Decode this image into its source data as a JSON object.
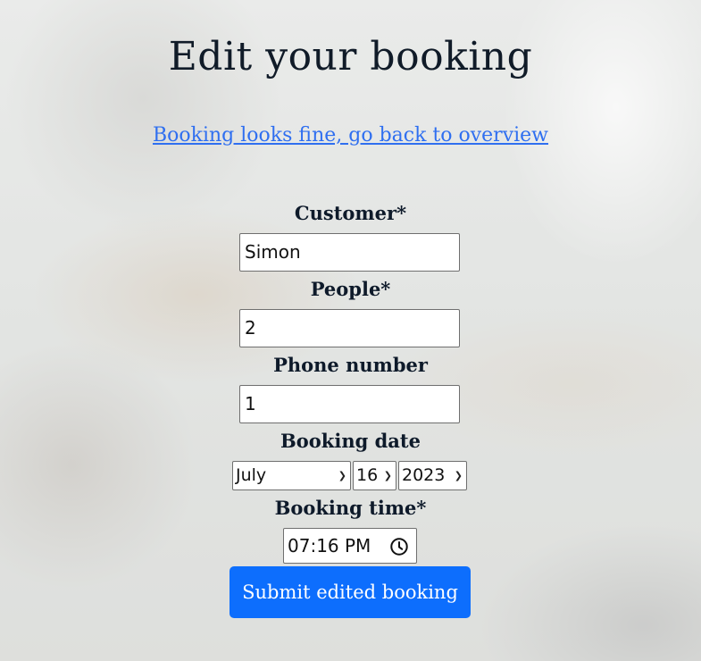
{
  "page": {
    "title": "Edit your booking",
    "back_link": "Booking looks fine, go back to overview"
  },
  "form": {
    "customer": {
      "label": "Customer*",
      "value": "Simon"
    },
    "people": {
      "label": "People*",
      "value": "2"
    },
    "phone": {
      "label": "Phone number",
      "value": "1"
    },
    "booking_date": {
      "label": "Booking date",
      "month": "July",
      "day": "16",
      "year": "2023"
    },
    "booking_time": {
      "label": "Booking time*",
      "value": "07:16 PM"
    },
    "submit_label": "Submit edited booking"
  },
  "colors": {
    "accent": "#0d6efd",
    "link": "#2f6ff0",
    "text": "#0e1a2a"
  }
}
